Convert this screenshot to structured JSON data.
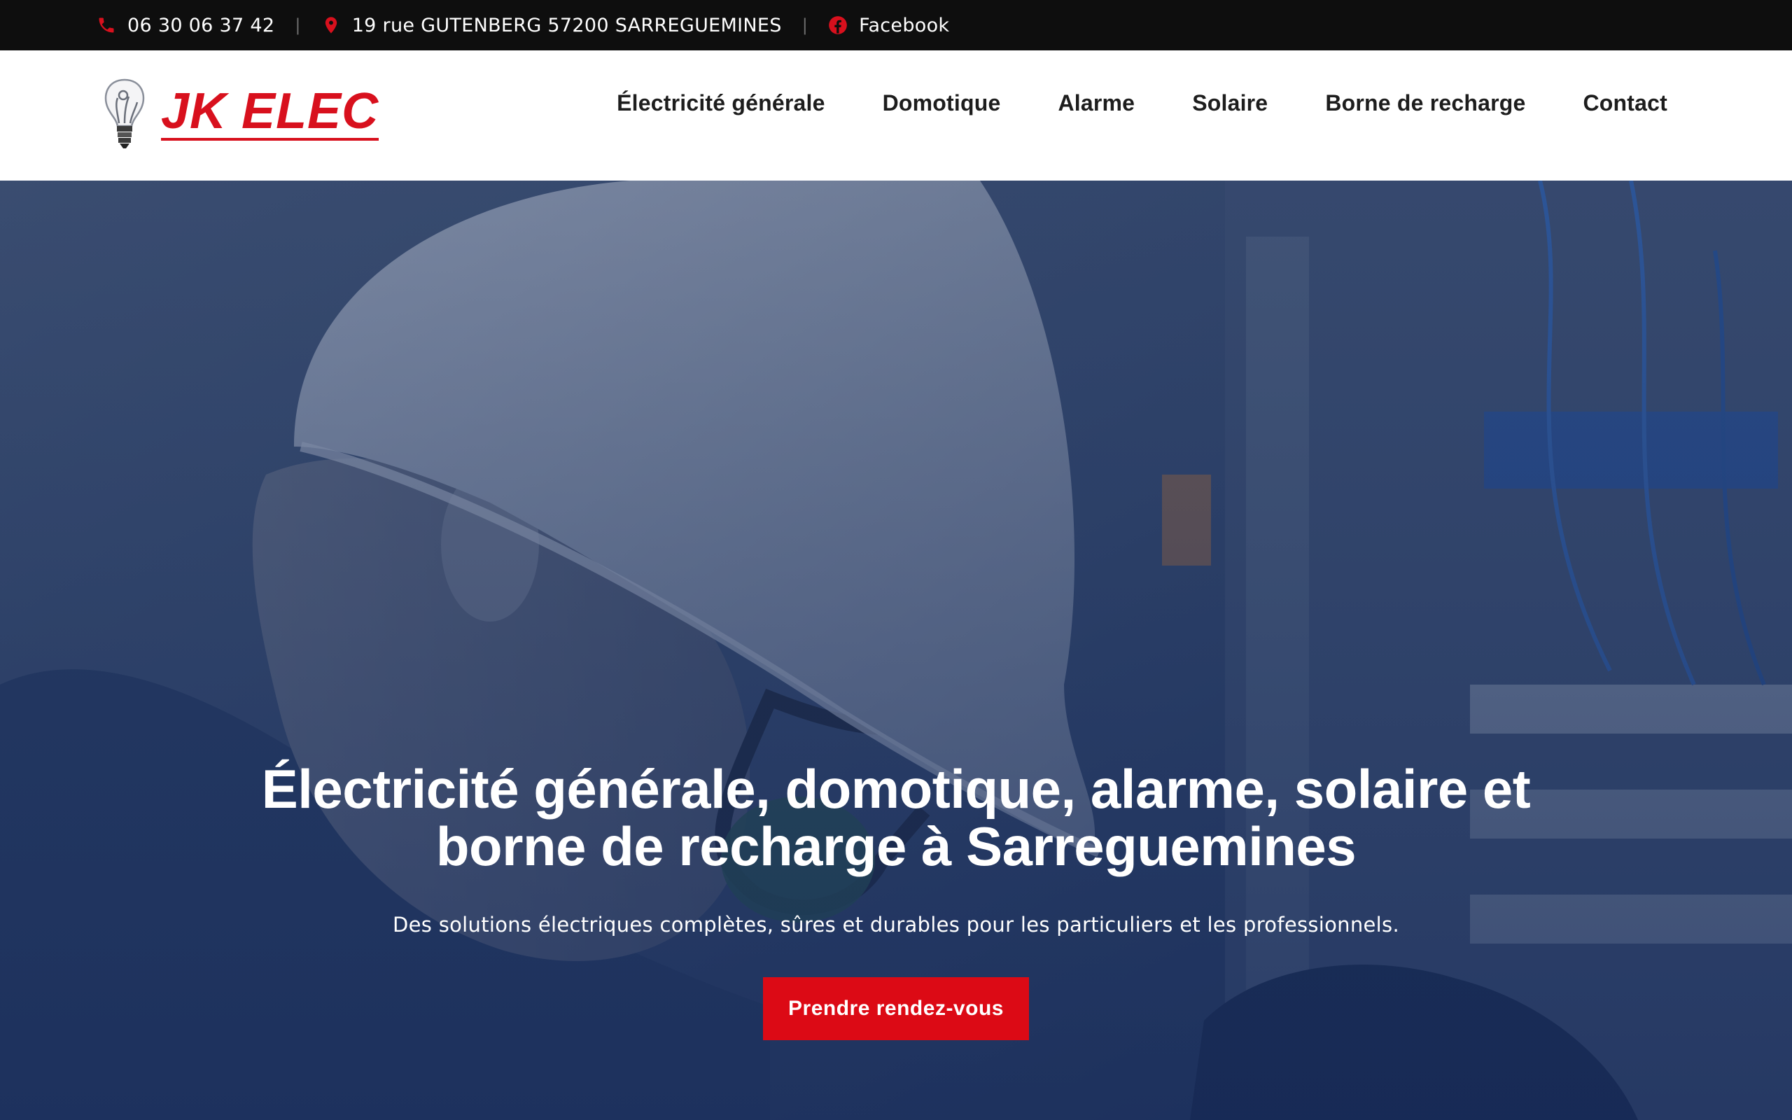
{
  "topbar": {
    "phone": "06 30 06 37 42",
    "address": "19 rue GUTENBERG 57200 SARREGUEMINES",
    "social": "Facebook",
    "separator": "|",
    "icons": [
      "phone-icon",
      "map-pin-icon",
      "facebook-icon"
    ],
    "icon_color": "#d8101d"
  },
  "header": {
    "logo_text": "JK ELEC",
    "nav": [
      {
        "label": "Électricité générale"
      },
      {
        "label": "Domotique"
      },
      {
        "label": "Alarme"
      },
      {
        "label": "Solaire"
      },
      {
        "label": "Borne de recharge"
      },
      {
        "label": "Contact"
      }
    ]
  },
  "hero": {
    "title_line1": "Électricité générale, domotique, alarme, solaire et",
    "title_line2": "borne de recharge à Sarreguemines",
    "subtitle": "Des solutions électriques complètes, sûres et durables pour les particuliers et les professionnels.",
    "cta_label": "Prendre rendez-vous",
    "overlay_color": "#1e3560",
    "cta_color": "#dc0a15"
  },
  "colors": {
    "topbar_bg": "#0e0e0e",
    "brand_red": "#d8101d",
    "nav_text": "#1d1d1d"
  }
}
